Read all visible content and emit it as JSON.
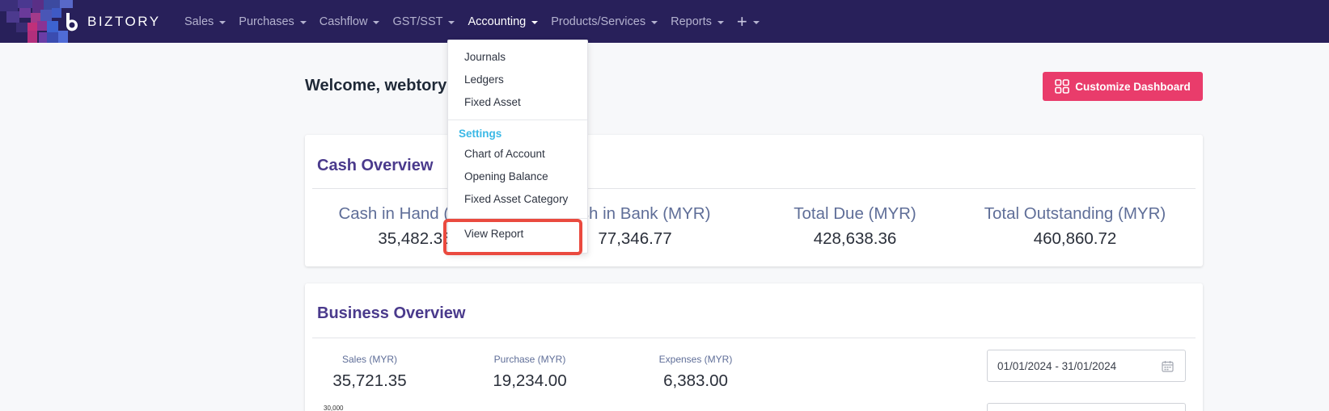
{
  "brand": {
    "name": "BIZTORY"
  },
  "nav": {
    "items": [
      {
        "label": "Sales",
        "active": false
      },
      {
        "label": "Purchases",
        "active": false
      },
      {
        "label": "Cashflow",
        "active": false
      },
      {
        "label": "GST/SST",
        "active": false
      },
      {
        "label": "Accounting",
        "active": true
      },
      {
        "label": "Products/Services",
        "active": false
      },
      {
        "label": "Reports",
        "active": false
      }
    ],
    "plus_label": "+"
  },
  "dropdown": {
    "items": [
      "Journals",
      "Ledgers",
      "Fixed Asset"
    ],
    "settings_header": "Settings",
    "settings_items": [
      "Chart of Account",
      "Opening Balance",
      "Fixed Asset Category"
    ],
    "report_item": "View Report"
  },
  "main": {
    "welcome": "Welcome, webtory!",
    "customize_label": "Customize Dashboard"
  },
  "cash_overview": {
    "title": "Cash Overview",
    "stats": [
      {
        "label": "Cash in Hand (MYR)",
        "value": "35,482.35"
      },
      {
        "label": "Cash in Bank (MYR)",
        "value": "77,346.77"
      },
      {
        "label": "Total Due (MYR)",
        "value": "428,638.36"
      },
      {
        "label": "Total Outstanding (MYR)",
        "value": "460,860.72"
      }
    ]
  },
  "business_overview": {
    "title": "Business Overview",
    "stats": [
      {
        "label": "Sales (MYR)",
        "value": "35,721.35"
      },
      {
        "label": "Purchase (MYR)",
        "value": "19,234.00"
      },
      {
        "label": "Expenses (MYR)",
        "value": "6,383.00"
      }
    ],
    "date_range": "01/01/2024 - 31/01/2024",
    "chart_tick": "30,000"
  },
  "colors": {
    "navbar": "#28205a",
    "accent_pink": "#e93c6b",
    "card_title": "#4a3a8c",
    "settings_header": "#3ab8e6",
    "highlight": "#ea4a3f"
  }
}
